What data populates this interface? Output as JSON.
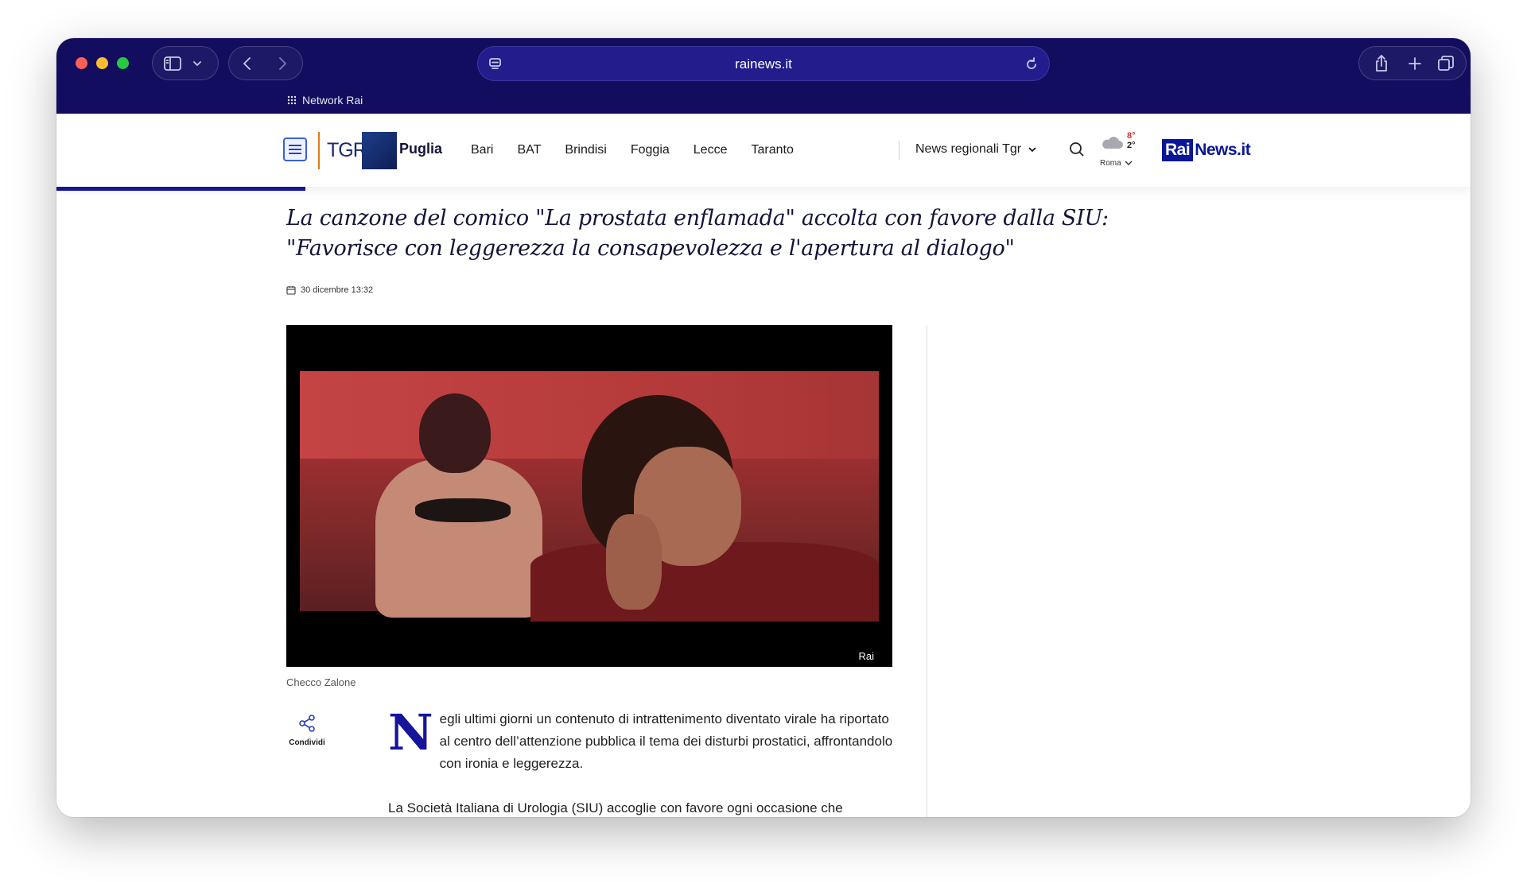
{
  "browser": {
    "url": "rainews.it",
    "bookmark_label": "Network Rai"
  },
  "header": {
    "section": "Puglia",
    "logo_text": "TGR",
    "nav_links": [
      "Bari",
      "BAT",
      "Brindisi",
      "Foggia",
      "Lecce",
      "Taranto"
    ],
    "regional_news_label": "News regionali Tgr",
    "weather": {
      "high": "8°",
      "low": "2°",
      "city": "Roma"
    },
    "brand": {
      "rai": "Rai",
      "news": "News.it"
    }
  },
  "article": {
    "title": "La canzone del comico \"La prostata enflamada\" accolta con favore dalla SIU: \"Favorisce con leggerezza la consapevolezza e l'apertura al dialogo\"",
    "date": "30 dicembre 13:32",
    "video_watermark": "Rai",
    "caption": "Checco Zalone",
    "share_label": "Condividi",
    "dropcap": "N",
    "paragraph1": "egli ultimi giorni un contenuto di intrattenimento diventato virale ha riportato al centro dell’attenzione pubblica il tema dei disturbi prostatici, affrontandolo con ironia e leggerezza.",
    "paragraph2": "La Società Italiana di Urologia (SIU) accoglie con favore ogni occasione che"
  },
  "colors": {
    "chrome": "#120d5f",
    "accent": "#15149a",
    "title": "#14143a"
  }
}
